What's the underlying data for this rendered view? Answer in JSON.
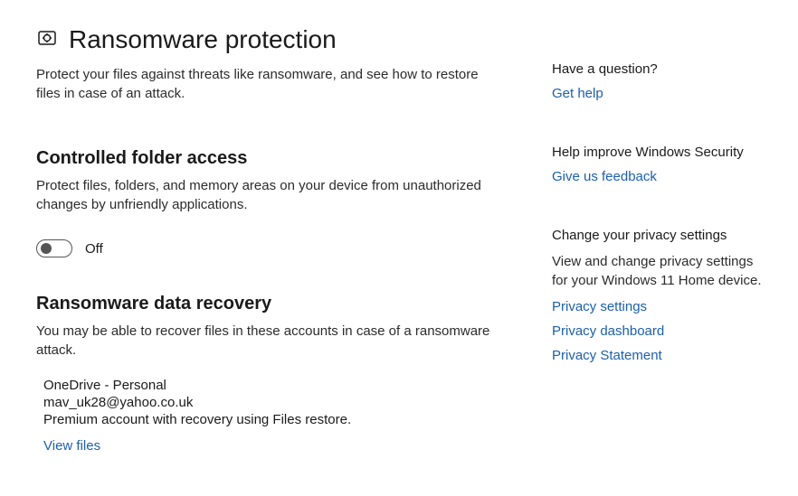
{
  "header": {
    "title": "Ransomware protection",
    "intro": "Protect your files against threats like ransomware, and see how to restore files in case of an attack."
  },
  "controlled_folder": {
    "heading": "Controlled folder access",
    "desc": "Protect files, folders, and memory areas on your device from unauthorized changes by unfriendly applications.",
    "toggle_state": "Off"
  },
  "recovery": {
    "heading": "Ransomware data recovery",
    "desc": "You may be able to recover files in these accounts in case of a ransomware attack.",
    "account_name": "OneDrive - Personal",
    "account_email": "mav_uk28@yahoo.co.uk",
    "account_note": "Premium account with recovery using Files restore.",
    "view_files": "View files"
  },
  "sidebar": {
    "question": {
      "heading": "Have a question?",
      "link": "Get help"
    },
    "improve": {
      "heading": "Help improve Windows Security",
      "link": "Give us feedback"
    },
    "privacy": {
      "heading": "Change your privacy settings",
      "desc": "View and change privacy settings for your Windows 11 Home device.",
      "link1": "Privacy settings",
      "link2": "Privacy dashboard",
      "link3": "Privacy Statement"
    }
  }
}
